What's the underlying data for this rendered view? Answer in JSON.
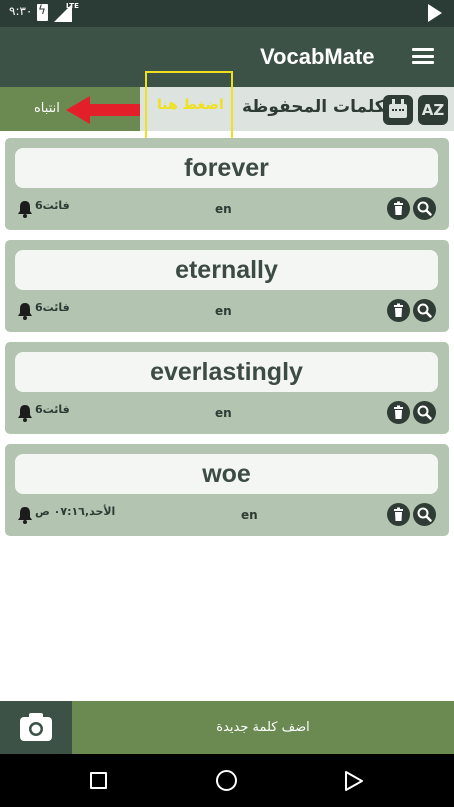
{
  "status_bar": {
    "time": "٩:٣٠",
    "network": "LTE"
  },
  "app_bar": {
    "title": "VocabMate"
  },
  "toolbar": {
    "alert_label": "انتباه",
    "hint_label": "اضغط هنا",
    "saved_words_label": "الكلمات المحفوظة",
    "sort_az_label": "AZ"
  },
  "words": [
    {
      "word": "forever",
      "lang": "en",
      "due": "6فائت"
    },
    {
      "word": "eternally",
      "lang": "en",
      "due": "6فائت"
    },
    {
      "word": "everlastingly",
      "lang": "en",
      "due": "6فائت"
    },
    {
      "word": "woe",
      "lang": "en",
      "due": "الأحد,٠٧:١٦ ص"
    }
  ],
  "bottom_bar": {
    "add_word_label": "اضف كلمة جديدة"
  },
  "colors": {
    "app_bar": "#3c5246",
    "accent_green": "#6a8a52",
    "card_bg": "#b3c4b0",
    "hint_yellow": "#f0e020",
    "arrow_red": "#e3202a"
  },
  "icons": [
    "menu-icon",
    "calendar-icon",
    "sort-az-icon",
    "bell-icon",
    "trash-icon",
    "search-icon",
    "camera-icon",
    "arrow-left-icon"
  ]
}
